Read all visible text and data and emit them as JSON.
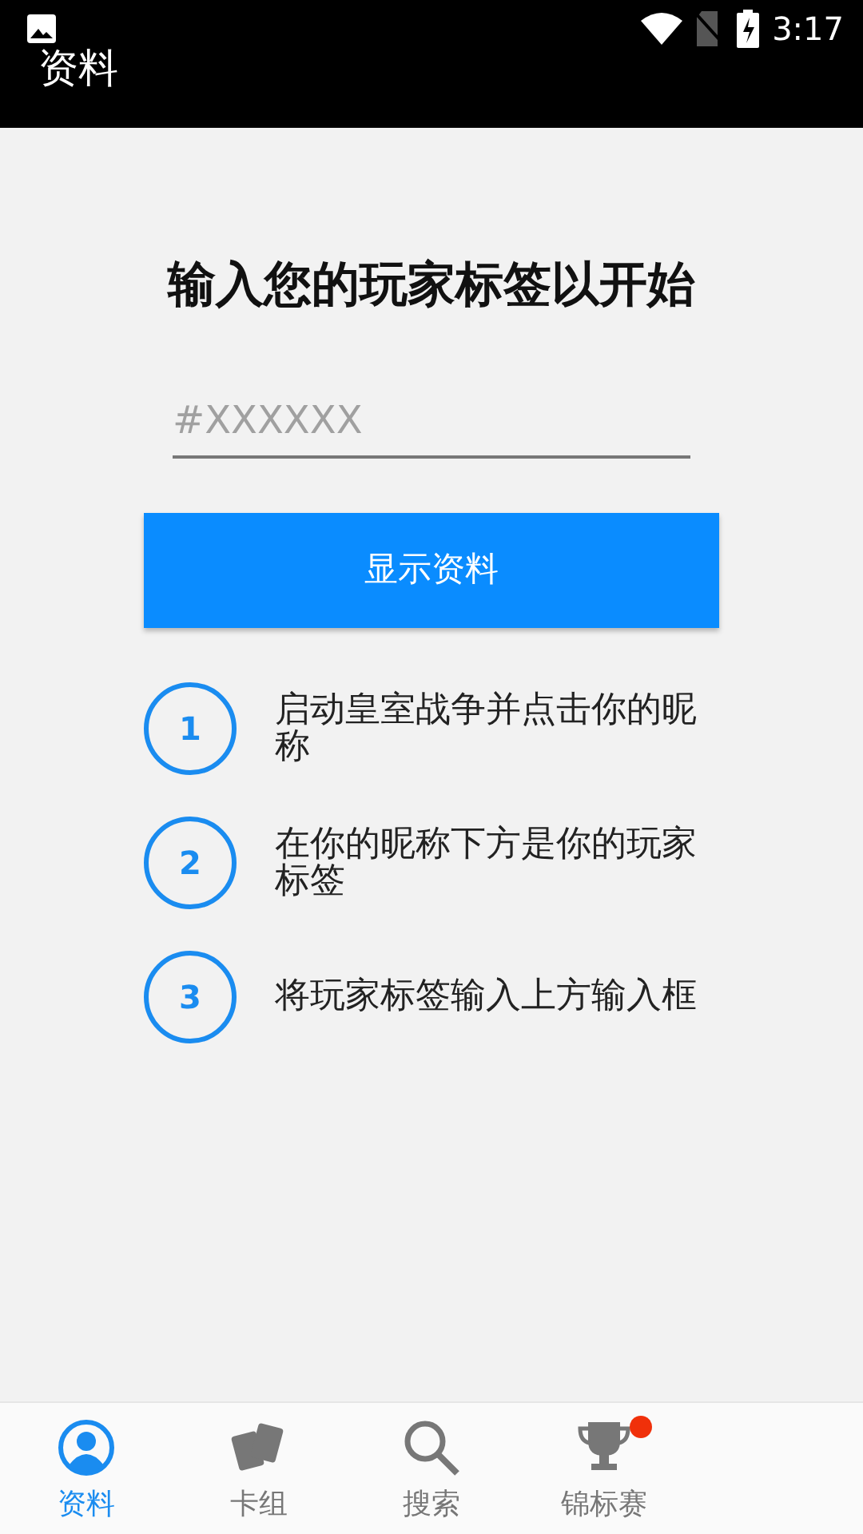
{
  "status_bar": {
    "time": "3:17"
  },
  "app_bar": {
    "title": "资料"
  },
  "heading": "输入您的玩家标签以开始",
  "tag_field": {
    "placeholder": "#XXXXXX"
  },
  "show_button": "显示资料",
  "steps": [
    {
      "number": "1",
      "text": "启动皇室战争并点击你的昵称"
    },
    {
      "number": "2",
      "text": "在你的昵称下方是你的玩家标签"
    },
    {
      "number": "3",
      "text": "将玩家标签输入上方输入框"
    }
  ],
  "bottom_nav": [
    {
      "kind": "profile",
      "label": "资料",
      "selected": true
    },
    {
      "kind": "cards",
      "label": "卡组",
      "selected": false
    },
    {
      "kind": "search",
      "label": "搜索",
      "selected": false
    },
    {
      "kind": "trophy",
      "label": "锦标赛",
      "selected": false,
      "badge": true
    }
  ]
}
